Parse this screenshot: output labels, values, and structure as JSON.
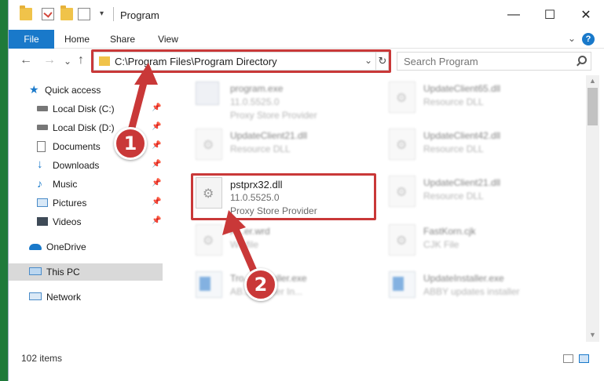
{
  "window": {
    "title": "Program",
    "controls": {
      "minimize": "—",
      "maximize": "☐",
      "close": "✕"
    }
  },
  "ribbon": {
    "tabs": [
      "File",
      "Home",
      "Share",
      "View"
    ],
    "help": "?"
  },
  "address_bar": {
    "path": "C:\\Program Files\\Program Directory",
    "dropdown": "⌄",
    "refresh": "↻"
  },
  "search": {
    "placeholder": "Search Program"
  },
  "nav": {
    "back": "←",
    "forward": "→",
    "recent": "⌄",
    "up": "↑"
  },
  "sidebar": {
    "items": [
      {
        "label": "Quick access",
        "icon": "star-icon",
        "pinned": false
      },
      {
        "label": "Local Disk (C:)",
        "icon": "drive-icon",
        "pinned": true
      },
      {
        "label": "Local Disk (D:)",
        "icon": "drive-icon",
        "pinned": true
      },
      {
        "label": "Documents",
        "icon": "documents-icon",
        "pinned": true
      },
      {
        "label": "Downloads",
        "icon": "download-icon",
        "pinned": true
      },
      {
        "label": "Music",
        "icon": "music-icon",
        "pinned": true
      },
      {
        "label": "Pictures",
        "icon": "pictures-icon",
        "pinned": true
      },
      {
        "label": "Videos",
        "icon": "videos-icon",
        "pinned": true
      },
      {
        "label": "OneDrive",
        "icon": "cloud-icon",
        "pinned": false
      },
      {
        "label": "This PC",
        "icon": "computer-icon",
        "pinned": false,
        "selected": true
      },
      {
        "label": "Network",
        "icon": "network-icon",
        "pinned": false
      }
    ]
  },
  "files": [
    {
      "name": "program.exe",
      "sub1": "11.0.5525.0",
      "sub2": "Proxy Store Provider",
      "icon": "exe-icon"
    },
    {
      "name": "UpdateClient65.dll",
      "sub1": "Resource DLL",
      "icon": "dll-icon"
    },
    {
      "name": "UpdateClient21.dll",
      "sub1": "Resource DLL",
      "icon": "dll-icon"
    },
    {
      "name": "UpdateClient42.dll",
      "sub1": "Resource DLL",
      "icon": "dll-icon"
    },
    {
      "name": "pstprx32.dll",
      "sub1": "11.0.5525.0",
      "sub2": "Proxy Store Provider",
      "icon": "dll-icon",
      "highlighted": true
    },
    {
      "name": "UpdateClient21.dll",
      "sub1": "Resource DLL",
      "icon": "dll-icon"
    },
    {
      "name": "A...er.wrd",
      "sub1": "W...file",
      "icon": "file-icon"
    },
    {
      "name": "FastKorn.cjk",
      "sub1": "CJK File",
      "icon": "file-icon"
    },
    {
      "name": "Tro...sInstaller.exe",
      "sub1": "AB... Reader In...",
      "icon": "installer-icon"
    },
    {
      "name": "UpdateInstaller.exe",
      "sub1": "ABBY updates installer",
      "icon": "installer-icon"
    }
  ],
  "status": {
    "count": "102 items"
  },
  "steps": [
    "1",
    "2"
  ],
  "colors": {
    "accent": "#1979ca",
    "highlight": "#c93838"
  }
}
